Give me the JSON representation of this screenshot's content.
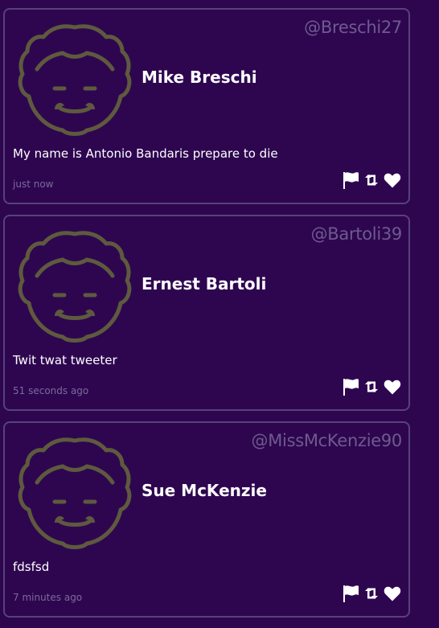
{
  "tweets": [
    {
      "handle": "@Breschi27",
      "name": "Mike Breschi",
      "body": "My name is Antonio Bandaris prepare to die",
      "timestamp": "just now",
      "avatar_icon": "smiley-face-avatar-icon",
      "actions": [
        "flag-icon",
        "retweet-icon",
        "heart-icon"
      ]
    },
    {
      "handle": "@Bartoli39",
      "name": "Ernest Bartoli",
      "body": "Twit twat tweeter",
      "timestamp": "51 seconds ago",
      "avatar_icon": "smiley-face-avatar-icon",
      "actions": [
        "flag-icon",
        "retweet-icon",
        "heart-icon"
      ]
    },
    {
      "handle": "@MissMcKenzie90",
      "name": "Sue McKenzie",
      "body": "fdsfsd",
      "timestamp": "7 minutes ago",
      "avatar_icon": "smiley-face-avatar-icon",
      "actions": [
        "flag-icon",
        "retweet-icon",
        "heart-icon"
      ]
    }
  ],
  "colors": {
    "background": "#2e0650",
    "card_border": "#57427a",
    "handle": "#6e5a8e",
    "timestamp": "#7c6a98",
    "avatar_stroke": "#5e5a3e",
    "text": "#ffffff"
  }
}
